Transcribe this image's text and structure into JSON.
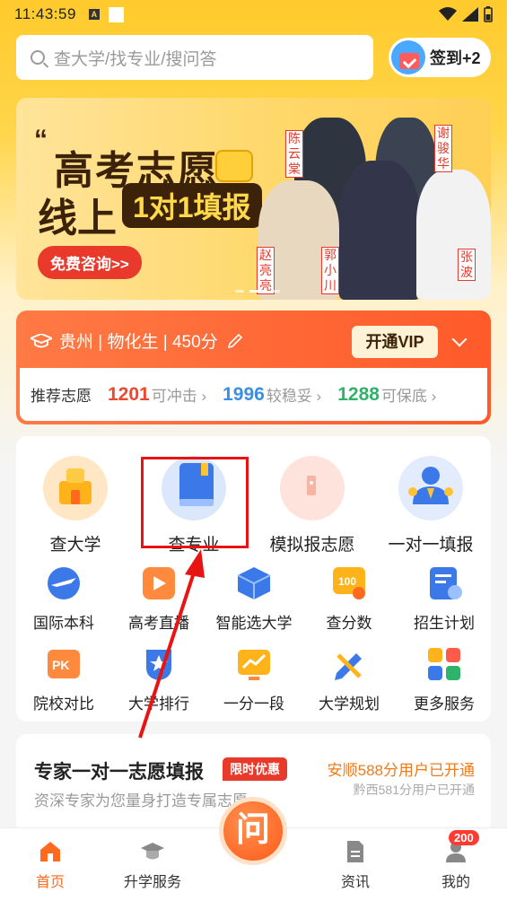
{
  "status": {
    "time": "11:43:59"
  },
  "search": {
    "placeholder": "查大学/找专业/搜问答"
  },
  "signin": {
    "label": "签到+2"
  },
  "banner": {
    "line1": "高考志愿",
    "line2": "线上",
    "pill": "1对1填报",
    "cta": "免费咨询>>",
    "names": [
      "陈云棠",
      "谢骏华",
      "赵亮亮",
      "郭小川",
      "张波"
    ]
  },
  "province": {
    "info": "贵州 | 物化生 | 450分",
    "vip": "开通VIP",
    "recommend": "推荐志愿",
    "stats": [
      {
        "num": "1201",
        "label": "可冲击 ›",
        "color": "#f0462c"
      },
      {
        "num": "1996",
        "label": "较稳妥 ›",
        "color": "#3a8ee6"
      },
      {
        "num": "1288",
        "label": "可保底 ›",
        "color": "#2fb36a"
      }
    ]
  },
  "services": {
    "big": [
      {
        "label": "查大学",
        "icon": "school-building-icon"
      },
      {
        "label": "查专业",
        "icon": "book-icon"
      },
      {
        "label": "模拟报志愿",
        "icon": "form-icon"
      },
      {
        "label": "一对一填报",
        "icon": "consultant-icon"
      }
    ],
    "small_row1": [
      {
        "label": "国际本科",
        "icon": "plane-icon"
      },
      {
        "label": "高考直播",
        "icon": "live-icon"
      },
      {
        "label": "智能选大学",
        "icon": "cube-icon"
      },
      {
        "label": "查分数",
        "icon": "score-icon"
      },
      {
        "label": "招生计划",
        "icon": "plan-icon"
      }
    ],
    "small_row2": [
      {
        "label": "院校对比",
        "icon": "pk-icon"
      },
      {
        "label": "大学排行",
        "icon": "ranking-icon"
      },
      {
        "label": "一分一段",
        "icon": "chart-icon"
      },
      {
        "label": "大学规划",
        "icon": "pencil-icon"
      },
      {
        "label": "更多服务",
        "icon": "grid-icon"
      }
    ]
  },
  "expert": {
    "title": "专家一对一志愿填报",
    "tag": "限时优惠",
    "subtitle": "资深专家为您量身打造专属志愿~",
    "right1": "安顺588分用户已开通",
    "right2": "黔西581分用户已开通"
  },
  "tabbar": {
    "home": "首页",
    "service": "升学服务",
    "center": "问",
    "news": "资讯",
    "mine": "我的",
    "badge": "200"
  }
}
